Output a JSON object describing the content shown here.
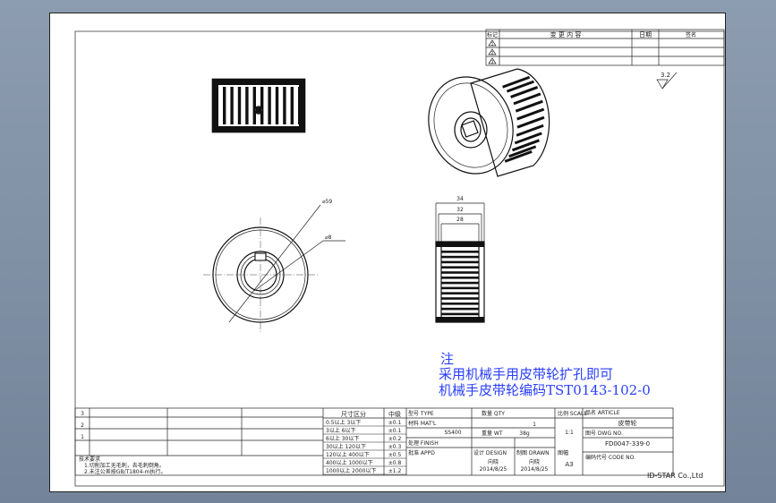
{
  "revision_block": {
    "col_mark": "标记",
    "col_change": "变  更  内  容",
    "col_date": "日期",
    "col_sign": "签名",
    "rows": [
      "1",
      "2",
      "3"
    ]
  },
  "surface_finish": "3.2",
  "dimensions": {
    "outer_dia": "⌀59",
    "hole_dia": "⌀8",
    "width_total": "34",
    "width_mid": "32",
    "width_teeth": "28"
  },
  "note": {
    "heading": "注",
    "line1": "采用机械手用皮带轮扩孔即可",
    "line2": "机械手皮带轮编码TST0143-102-0"
  },
  "title_block": {
    "tech_req_title": "技术要求",
    "tech_req_1": "1.切削加工无毛刺，去毛刺倒角。",
    "tech_req_2": "2.未注公差按GB/T1804-m执行。",
    "tol_header_size": "尺寸区分",
    "tol_header_grade": "中级",
    "tol_rows": [
      {
        "size": "0.5以上  3以下",
        "tol": "±0.1"
      },
      {
        "size": "3以上  6以下",
        "tol": "±0.1"
      },
      {
        "size": "6以上  30以下",
        "tol": "±0.2"
      },
      {
        "size": "30以上  120以下",
        "tol": "±0.3"
      },
      {
        "size": "120以上  400以下",
        "tol": "±0.5"
      },
      {
        "size": "400以上  1000以下",
        "tol": "±0.8"
      },
      {
        "size": "1000以上  2000以下",
        "tol": "±1.2"
      }
    ],
    "type_label": "型号 TYPE",
    "material_label": "材料 MAT'L",
    "material_value": "SS400",
    "finish_label": "处理 FINISH",
    "approved_label": "批准 APPD",
    "design_label": "设计 DESIGN",
    "drawn_label": "制图 DRAWN",
    "qty_label": "数量 QTY",
    "qty_value": "1",
    "weight_label": "重量 WT",
    "weight_value": "38g",
    "scale_label": "比例 SCALE",
    "scale_value": "1:1",
    "size_label": "图幅",
    "size_value": "A3",
    "designer": "向晓",
    "drafter": "向晓",
    "design_date": "2014/8/25",
    "drawn_date": "2014/8/25",
    "name_label": "品名 ARTICLE",
    "name_value": "皮带轮",
    "drawing_no_label": "图号 DWG NO.",
    "drawing_no_value": "FD0047-339-0",
    "code_label": "编码代号 CODE NO.",
    "company": "ID-STAR Co.,Ltd"
  },
  "left_rows": [
    "3",
    "2",
    "1"
  ]
}
